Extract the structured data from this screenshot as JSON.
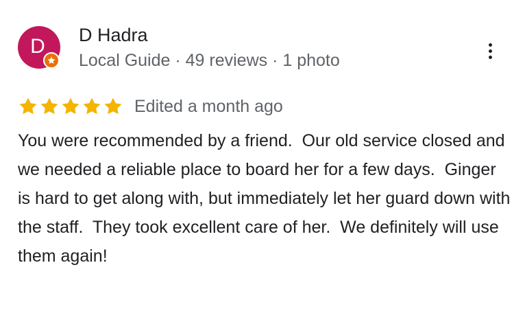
{
  "reviewer": {
    "initial": "D",
    "name": "D Hadra",
    "meta": "Local Guide · 49 reviews · 1 photo",
    "avatar_color": "#c2185b",
    "badge_color": "#e8710a",
    "badge_icon": "star-icon"
  },
  "menu": {
    "icon": "more-vertical-icon"
  },
  "rating": {
    "stars": 5,
    "max_stars": 5,
    "star_color": "#f4b400",
    "edited": "Edited a month ago"
  },
  "review": {
    "text": "You were recommended by a friend.  Our old service closed and we needed a reliable place to board her for a few days.  Ginger is hard to get along with, but immediately let her guard down with the staff.  They took excellent care of her.  We definitely will use them again!"
  }
}
